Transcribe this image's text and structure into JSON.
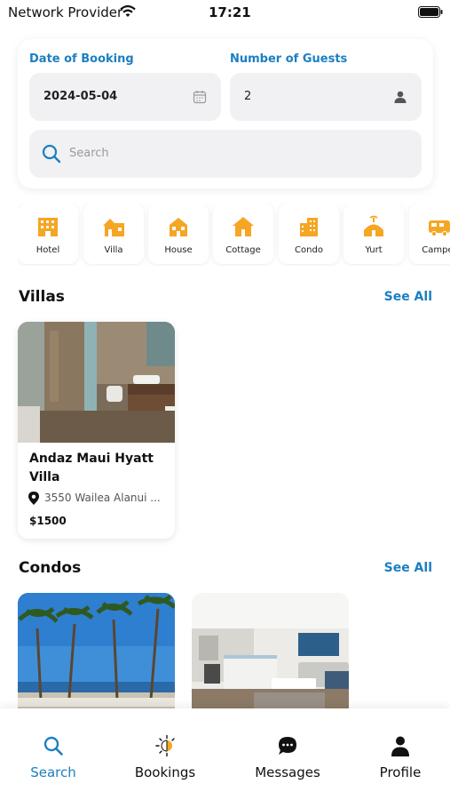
{
  "status_bar": {
    "carrier": "Network Provider",
    "time": "17:21"
  },
  "search_form": {
    "date_label": "Date of Booking",
    "date_value": "2024-05-04",
    "guests_label": "Number of Guests",
    "guests_value": "2",
    "search_placeholder": "Search"
  },
  "categories": [
    {
      "label": "Hotel",
      "icon": "hotel-icon"
    },
    {
      "label": "Villa",
      "icon": "villa-icon"
    },
    {
      "label": "House",
      "icon": "house-icon"
    },
    {
      "label": "Cottage",
      "icon": "cottage-icon"
    },
    {
      "label": "Condo",
      "icon": "condo-icon"
    },
    {
      "label": "Yurt",
      "icon": "yurt-icon"
    },
    {
      "label": "Camper",
      "icon": "camper-icon"
    }
  ],
  "villas": {
    "title": "Villas",
    "see_all": "See All",
    "items": [
      {
        "name": "Andaz Maui Hyatt Villa",
        "address": "3550 Wailea Alanui ...",
        "price": "$1500"
      }
    ]
  },
  "condos": {
    "title": "Condos",
    "see_all": "See All"
  },
  "tabs": [
    {
      "label": "Search",
      "icon": "search-icon",
      "active": true
    },
    {
      "label": "Bookings",
      "icon": "sun-icon",
      "active": false
    },
    {
      "label": "Messages",
      "icon": "chat-icon",
      "active": false
    },
    {
      "label": "Profile",
      "icon": "person-icon",
      "active": false
    }
  ],
  "colors": {
    "accent": "#1b7fc2",
    "category_icon": "#f5a623",
    "field_bg": "#f1f1f3"
  }
}
